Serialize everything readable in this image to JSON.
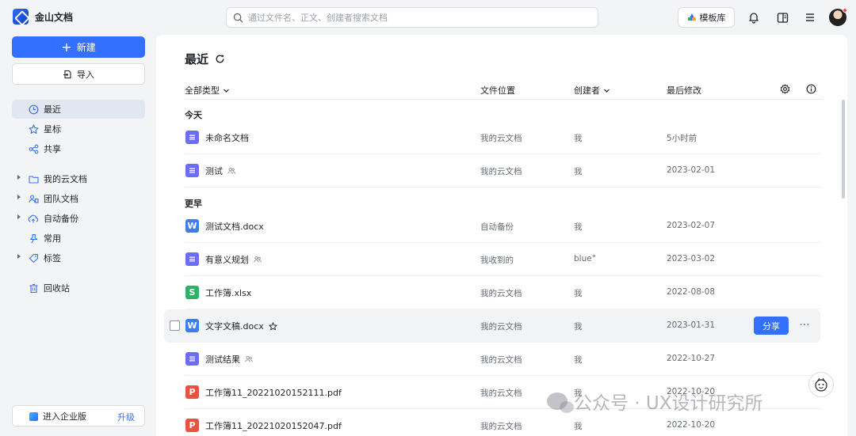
{
  "app": {
    "name": "金山文档"
  },
  "search": {
    "placeholder": "通过文件名、正文、创建者搜索文档"
  },
  "topbar": {
    "template_label": "模板库"
  },
  "sidebar": {
    "new_label": "新建",
    "import_label": "导入",
    "primary": [
      {
        "label": "最近",
        "icon": "clock-icon",
        "active": true
      },
      {
        "label": "星标",
        "icon": "star-icon",
        "active": false
      },
      {
        "label": "共享",
        "icon": "share-icon",
        "active": false
      }
    ],
    "folders": [
      {
        "label": "我的云文档",
        "icon": "folder-icon",
        "expandable": true
      },
      {
        "label": "团队文档",
        "icon": "team-icon",
        "expandable": true
      },
      {
        "label": "自动备份",
        "icon": "cloud-backup-icon",
        "expandable": true
      },
      {
        "label": "常用",
        "icon": "pin-icon",
        "expandable": false
      },
      {
        "label": "标签",
        "icon": "tag-icon",
        "expandable": true
      }
    ],
    "trash_label": "回收站",
    "enterprise_label": "进入企业版",
    "upgrade_label": "升级"
  },
  "main": {
    "title": "最近",
    "columns": {
      "type": "全部类型",
      "location": "文件位置",
      "creator": "创建者",
      "modified": "最后修改"
    },
    "sections": [
      {
        "label": "今天"
      },
      {
        "label": "更早"
      }
    ],
    "files": [
      {
        "name": "未命名文档",
        "type": "doc",
        "shared": false,
        "location": "我的云文档",
        "creator": "我",
        "modified": "5小时前"
      },
      {
        "name": "测试",
        "type": "doc",
        "shared": true,
        "location": "我的云文档",
        "creator": "我",
        "modified": "2023-02-01"
      },
      {
        "name": "测试文档.docx",
        "type": "word",
        "shared": false,
        "location": "自动备份",
        "creator": "我",
        "modified": "2023-02-07"
      },
      {
        "name": "有意义规划",
        "type": "doc",
        "shared": true,
        "location": "我收到的",
        "creator": "blue°",
        "modified": "2023-03-02"
      },
      {
        "name": "工作簿.xlsx",
        "type": "sheet",
        "shared": false,
        "location": "我的云文档",
        "creator": "我",
        "modified": "2022-08-08"
      },
      {
        "name": "文字文稿.docx",
        "type": "word",
        "shared": false,
        "starrable": true,
        "hover": true,
        "location": "我的云文档",
        "creator": "我",
        "modified": "2023-01-31"
      },
      {
        "name": "测试结果",
        "type": "doc",
        "shared": true,
        "location": "我的云文档",
        "creator": "我",
        "modified": "2022-10-27"
      },
      {
        "name": "工作簿11_20221020152111.pdf",
        "type": "pdf",
        "shared": false,
        "location": "我的云文档",
        "creator": "我",
        "modified": "2022-10-20"
      },
      {
        "name": "工作簿11_20221020152047.pdf",
        "type": "pdf",
        "shared": false,
        "location": "我的云文档",
        "creator": "我",
        "modified": "2022-10-20"
      }
    ],
    "row_actions": {
      "share_label": "分享",
      "more_label": "···"
    }
  },
  "file_icon_letters": {
    "doc": "≡",
    "word": "W",
    "sheet": "S",
    "pdf": "P"
  },
  "watermark": {
    "text": "公众号 · UX设计研究所"
  },
  "colors": {
    "accent": "#3370ff",
    "doc": "#6b6ef5",
    "word": "#3c7ef0",
    "sheet": "#2fb266",
    "pdf": "#e8533f"
  }
}
